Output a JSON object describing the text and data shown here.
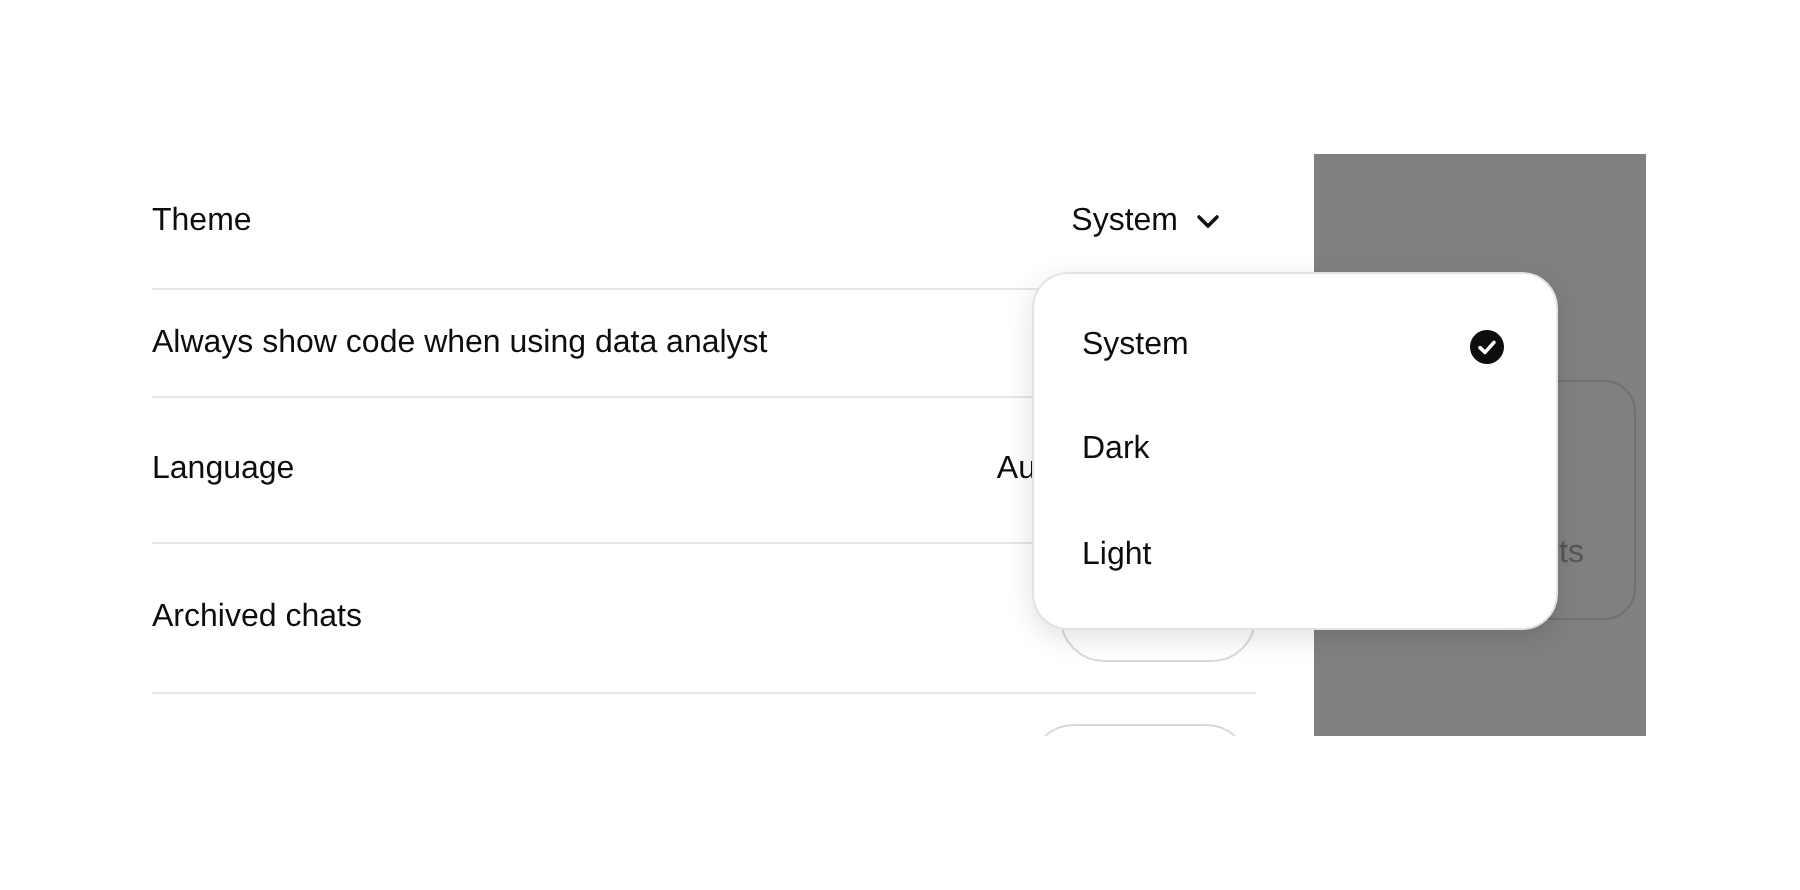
{
  "settings": [
    {
      "kind": "dropdown",
      "label": "Theme",
      "value": "System"
    },
    {
      "kind": "plain",
      "label": "Always show code when using data analyst"
    },
    {
      "kind": "value",
      "label": "Language",
      "value": "Au"
    },
    {
      "kind": "button",
      "label": "Archived chats"
    },
    {
      "kind": "button"
    }
  ],
  "side_panel": {
    "card_text": "ts"
  },
  "theme_menu": {
    "items": [
      {
        "label": "System",
        "selected": true
      },
      {
        "label": "Dark",
        "selected": false
      },
      {
        "label": "Light",
        "selected": false
      }
    ]
  }
}
